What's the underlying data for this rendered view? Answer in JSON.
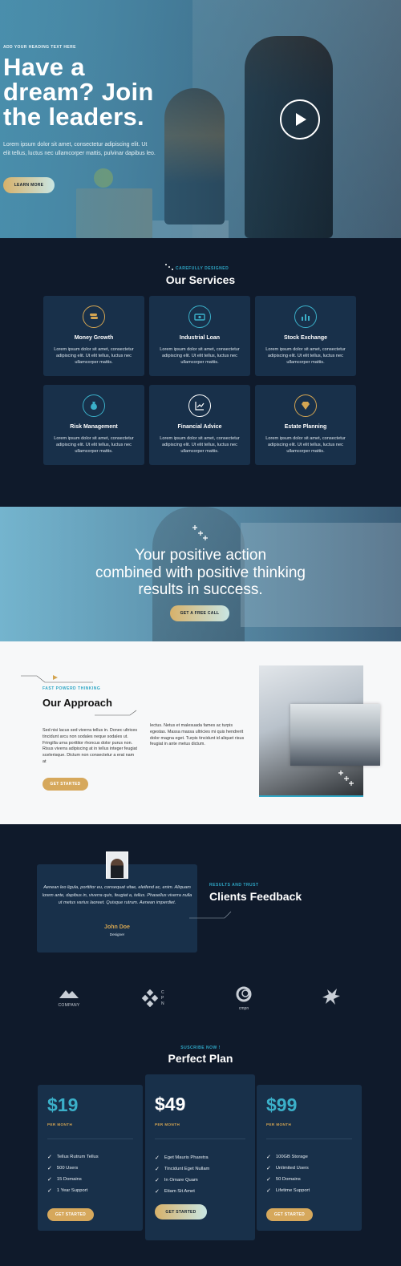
{
  "colors": {
    "navy": "#0f1a2b",
    "card": "#18304a",
    "gold": "#d4a552",
    "teal": "#2fa7c6"
  },
  "hero": {
    "eyebrow": "ADD YOUR HEADING TEXT HERE",
    "title_lines": [
      "Have a",
      "dream? Join",
      "the leaders."
    ],
    "text": "Lorem ipsum dolor sit amet, consectetur adipiscing elit. Ut elit tellus, luctus nec ullamcorper mattis, pulvinar dapibus leo.",
    "button": "LEARN MORE",
    "play_icon": "play-icon"
  },
  "services": {
    "label": "CAREFULLY DESIGNED",
    "title": "Our Services",
    "items": [
      {
        "title": "Money Growth",
        "desc": "Lorem ipsum dolor sit amet, consectetur adipiscing elit. Ut elit tellus, luctus nec ullamcorper mattis.",
        "icon": "coins-icon"
      },
      {
        "title": "Industrial Loan",
        "desc": "Lorem ipsum dolor sit amet, consectetur adipiscing elit. Ut elit tellus, luctus nec ullamcorper mattis.",
        "icon": "banknote-icon"
      },
      {
        "title": "Stock Exchange",
        "desc": "Lorem ipsum dolor sit amet, consectetur adipiscing elit. Ut elit tellus, luctus nec ullamcorper mattis.",
        "icon": "bar-chart-icon"
      },
      {
        "title": "Risk Management",
        "desc": "Lorem ipsum dolor sit amet, consectetur adipiscing elit. Ut elit tellus, luctus nec ullamcorper mattis.",
        "icon": "money-bag-icon"
      },
      {
        "title": "Financial Advice",
        "desc": "Lorem ipsum dolor sit amet, consectetur adipiscing elit. Ut elit tellus, luctus nec ullamcorper mattis.",
        "icon": "line-chart-icon"
      },
      {
        "title": "Estate Planning",
        "desc": "Lorem ipsum dolor sit amet, consectetur adipiscing elit. Ut elit tellus, luctus nec ullamcorper mattis.",
        "icon": "diamond-icon"
      }
    ]
  },
  "quote": {
    "lines": [
      "Your positive action",
      "combined with positive thinking",
      "results in success."
    ],
    "button": "GET A FREE CALL"
  },
  "approach": {
    "label": "FAST POWERD THINKING",
    "title": "Our Approach",
    "col1": "Sed nisi lacus sed viverra tellus in. Donec ultrices tincidunt arcu non sodales neque sodales ut. Fringilla urna porttitor rhoncus dolor purus non. Risus viverra adipiscing at in tellus integer feugiat scelerisque. Dictum non consectetur a erat nam at",
    "col2": "lectus. Netus et malesuada fames ac turpis egestas. Massa massa ultricies mi quis hendrerit dolor magna eget. Turpis tincidunt id aliquet risus feugiat in ante metus dictum.",
    "button": "GET STARTED"
  },
  "feedback": {
    "label": "RESULTS AND TRUST",
    "title": "Clients Feedback",
    "quote": "Aenean leo ligula, porttitor eu, consequat vitae, eleifend ac, enim. Aliquam lorem ante, dapibus in, viverra quis, feugiat a, tellus. Phasellus viverra nulla ut metus varius laoreet. Quisque rutrum. Aenean imperdiet.",
    "name": "John Doe",
    "role": "Designer",
    "logos": [
      {
        "text": "COMPANY",
        "icon": "mountain-logo-icon"
      },
      {
        "text": "C P N",
        "icon": "diamond-grid-logo-icon"
      },
      {
        "text": "cmpn",
        "icon": "ring-logo-icon"
      },
      {
        "text": "",
        "icon": "bird-logo-icon"
      }
    ]
  },
  "pricing": {
    "label": "SUSCRIBE NOW !",
    "title": "Perfect Plan",
    "plans": [
      {
        "price": "$19",
        "period": "PER MONTH",
        "features": [
          "Tellus Rutrum Tellus",
          "500 Users",
          "15 Domains",
          "1 Year Support"
        ],
        "button": "GET STARTED"
      },
      {
        "price": "$49",
        "period": "PER MONTH",
        "features": [
          "Eget Mauris Pharetra",
          "Tincidunt Eget Nullam",
          "In Ornare Quam",
          "Etiam Sit Amet"
        ],
        "button": "GET STARTED"
      },
      {
        "price": "$99",
        "period": "PER MONTH",
        "features": [
          "100GB Storage",
          "Unlimited Users",
          "50 Domains",
          "Lifetime Support"
        ],
        "button": "GET STARTED"
      }
    ]
  }
}
